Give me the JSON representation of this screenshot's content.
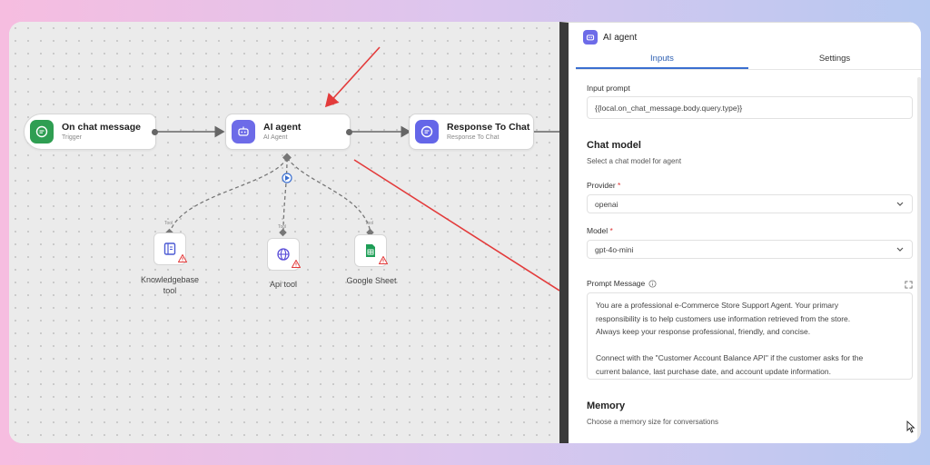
{
  "nodes": {
    "trigger": {
      "title": "On chat message",
      "sub": "Trigger"
    },
    "agent": {
      "title": "AI agent",
      "sub": "AI Agent"
    },
    "response": {
      "title": "Response To Chat",
      "sub": "Response To Chat"
    }
  },
  "tools": [
    {
      "tag": "Tool",
      "label_line1": "Knowledgebase",
      "label_line2": "tool",
      "icon": "book-icon"
    },
    {
      "tag": "Tool",
      "label_line1": "Api tool",
      "label_line2": "",
      "icon": "globe-icon"
    },
    {
      "tag": "Tool",
      "label_line1": "Google Sheet",
      "label_line2": "",
      "icon": "sheet-icon"
    }
  ],
  "panel": {
    "title": "AI agent",
    "tabs": [
      "Inputs",
      "Settings"
    ],
    "active_tab": "Inputs",
    "input_prompt_label": "Input prompt",
    "input_prompt_value": "{{local.on_chat_message.body.query.type}}",
    "chat_model_heading": "Chat model",
    "chat_model_hint": "Select a chat model for agent",
    "provider_label": "Provider",
    "provider_value": "openai",
    "model_label": "Model",
    "model_value": "gpt-4o-mini",
    "prompt_message_label": "Prompt Message",
    "prompt_lines": [
      "You are a professional e-Commerce Store Support Agent. Your primary",
      "responsibility is to help customers use information retrieved from the store.",
      "Always keep your response professional, friendly, and concise.",
      "",
      "Connect with the \"Customer Account Balance API\" if the customer asks for the",
      "current balance, last purchase date, and account update information."
    ],
    "memory_heading": "Memory",
    "memory_hint": "Choose a memory size for conversations",
    "required_mark": "*"
  },
  "colors": {
    "trigger_icon": "#2f9e52",
    "agent_icon": "#6d6be8",
    "response_icon": "#6466e8",
    "annotation_arrow": "#e33b3b",
    "active_tab": "#3a6fd0"
  }
}
